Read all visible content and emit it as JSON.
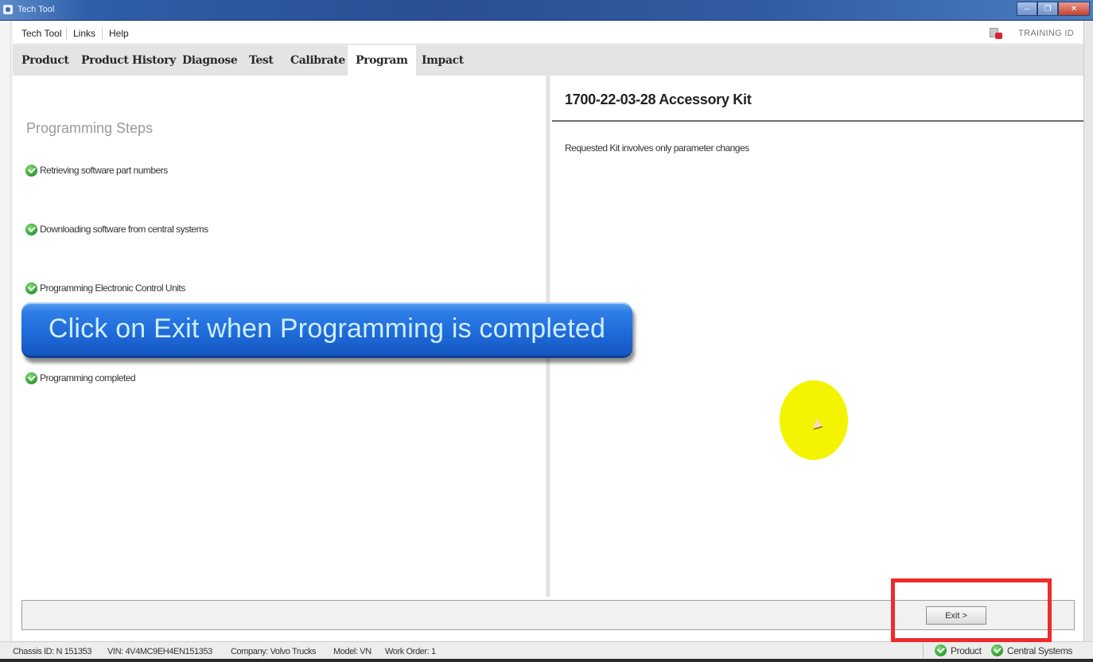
{
  "window": {
    "title": "Tech Tool",
    "controls": [
      "minimize",
      "restore",
      "close"
    ]
  },
  "menubar": {
    "items": [
      {
        "label": "Tech Tool"
      },
      {
        "label": "Links"
      },
      {
        "label": "Help"
      }
    ],
    "training_label": "TRAINING ID"
  },
  "tabs": [
    {
      "label": "Product",
      "active": false
    },
    {
      "label": "Product History",
      "active": false
    },
    {
      "label": "Diagnose",
      "active": false
    },
    {
      "label": "Test",
      "active": false
    },
    {
      "label": "Calibrate",
      "active": false
    },
    {
      "label": "Program",
      "active": true
    },
    {
      "label": "Impact",
      "active": false
    }
  ],
  "programming": {
    "title": "Programming Steps",
    "steps": [
      {
        "label": "Retrieving software part numbers",
        "status": "done"
      },
      {
        "label": "Downloading software from central systems",
        "status": "done"
      },
      {
        "label": "Programming Electronic Control Units",
        "status": "done"
      },
      {
        "label": "Programming completed",
        "status": "done"
      }
    ]
  },
  "kit": {
    "title": "1700-22-03-28 Accessory Kit",
    "description": "Requested Kit involves only parameter changes"
  },
  "buttons": {
    "exit_label": "Exit >"
  },
  "overlay": {
    "banner_text": "Click on Exit when Programming is completed",
    "highlight_color": "#ee2b2b",
    "cursor_halo_color": "#f4f400"
  },
  "statusbar": {
    "chassis_id": "Chassis ID: N 151353",
    "vin": "VIN: 4V4MC9EH4EN151353",
    "company": "Company: Volvo Trucks",
    "model": "Model: VN",
    "work_order": "Work Order: 1",
    "indicators": [
      {
        "label": "Product",
        "status": "ok"
      },
      {
        "label": "Central Systems",
        "status": "ok"
      }
    ]
  }
}
